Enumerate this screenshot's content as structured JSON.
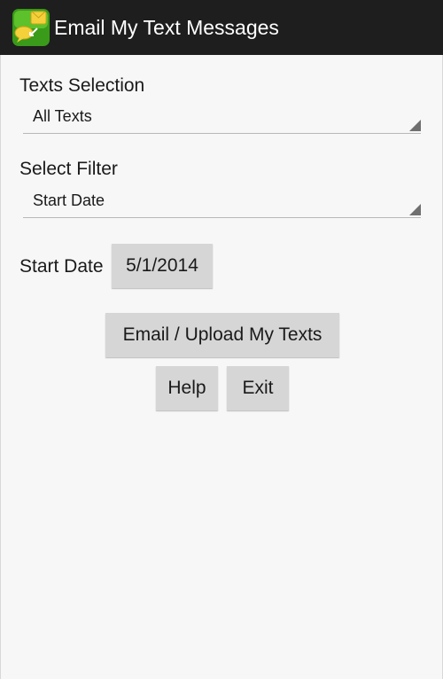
{
  "action_bar": {
    "title": "Email My Text Messages",
    "icon": "chat-bubbles-app-icon"
  },
  "texts_selection": {
    "label": "Texts Selection",
    "selected": "All Texts"
  },
  "filter": {
    "label": "Select Filter",
    "selected": "Start Date"
  },
  "start_date": {
    "label": "Start Date",
    "value": "5/1/2014"
  },
  "buttons": {
    "email_upload": "Email / Upload My Texts",
    "help": "Help",
    "exit": "Exit"
  },
  "colors": {
    "action_bar": "#1e1e1e",
    "background": "#f7f7f7",
    "button": "#d6d6d6",
    "icon_green": "#3a9a1a",
    "icon_yellow": "#f4d03a"
  }
}
